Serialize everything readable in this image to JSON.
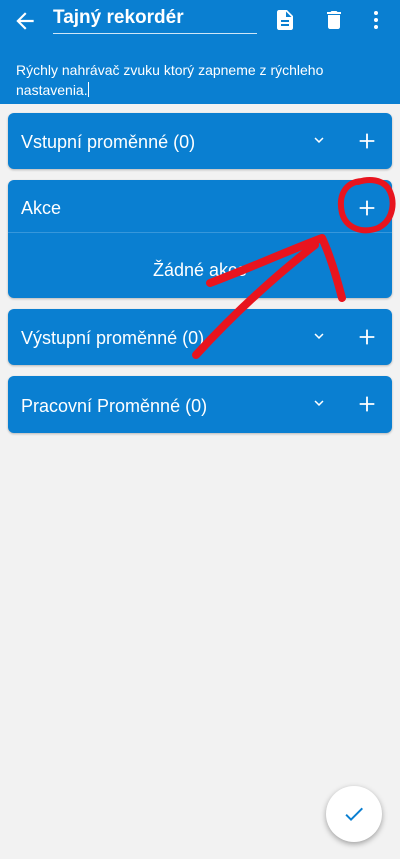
{
  "header": {
    "title": "Tajný rekordér",
    "description": "Rýchly nahrávač zvuku ktorý zapneme z rýchleho nastavenia."
  },
  "sections": [
    {
      "label": "Vstupní proměnné (0)"
    },
    {
      "label": "Akce",
      "empty_text": "Žádné akce"
    },
    {
      "label": "Výstupní proměnné (0)"
    },
    {
      "label": "Pracovní Proměnné (0)"
    }
  ],
  "icons": {
    "back": "arrow-left-icon",
    "document": "document-icon",
    "delete": "trash-icon",
    "more": "more-vert-icon",
    "expand": "chevron-down-icon",
    "add": "plus-icon",
    "confirm": "check-icon"
  },
  "colors": {
    "primary": "#0a7fd1",
    "background": "#f2f2f2",
    "annotation": "#e8141e"
  }
}
